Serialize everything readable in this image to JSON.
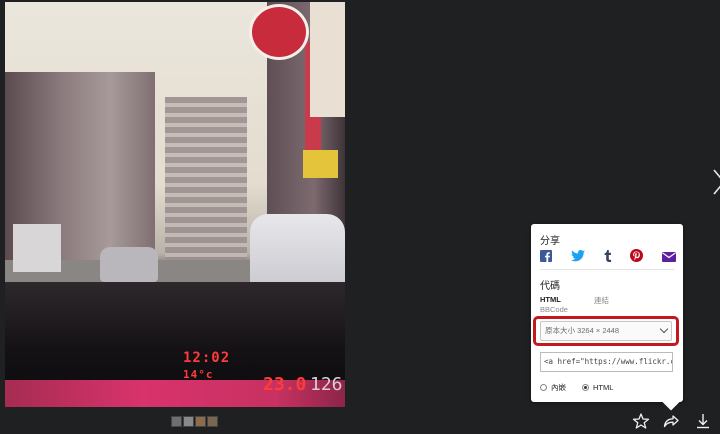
{
  "photo": {
    "dashboard_time": "12:02",
    "dashboard_temp": "14°c",
    "dashboard_mileage": "23.0",
    "dashboard_odometer": "126"
  },
  "share": {
    "title": "分享",
    "social_icons": [
      "facebook-icon",
      "twitter-icon",
      "tumblr-icon",
      "pinterest-icon",
      "email-icon"
    ],
    "embed_title": "代碼",
    "formats": {
      "html": "HTML",
      "bbcode": "BBCode",
      "link": "連結"
    },
    "size_select": "原本大小 3264 × 2448",
    "embed_code": "<a href=\"https://www.flickr.com",
    "radio_options": [
      {
        "label": "內嵌",
        "selected": false
      },
      {
        "label": "HTML",
        "selected": true
      }
    ]
  },
  "toolbar": {
    "icons": [
      "star-icon",
      "share-icon",
      "download-icon"
    ]
  },
  "colors": {
    "background": "#1f2021",
    "highlight": "#c2191f",
    "facebook": "#3b5998",
    "twitter": "#1da1f2",
    "tumblr": "#35465c",
    "pinterest": "#bd081c",
    "email": "#5d1f9e"
  }
}
